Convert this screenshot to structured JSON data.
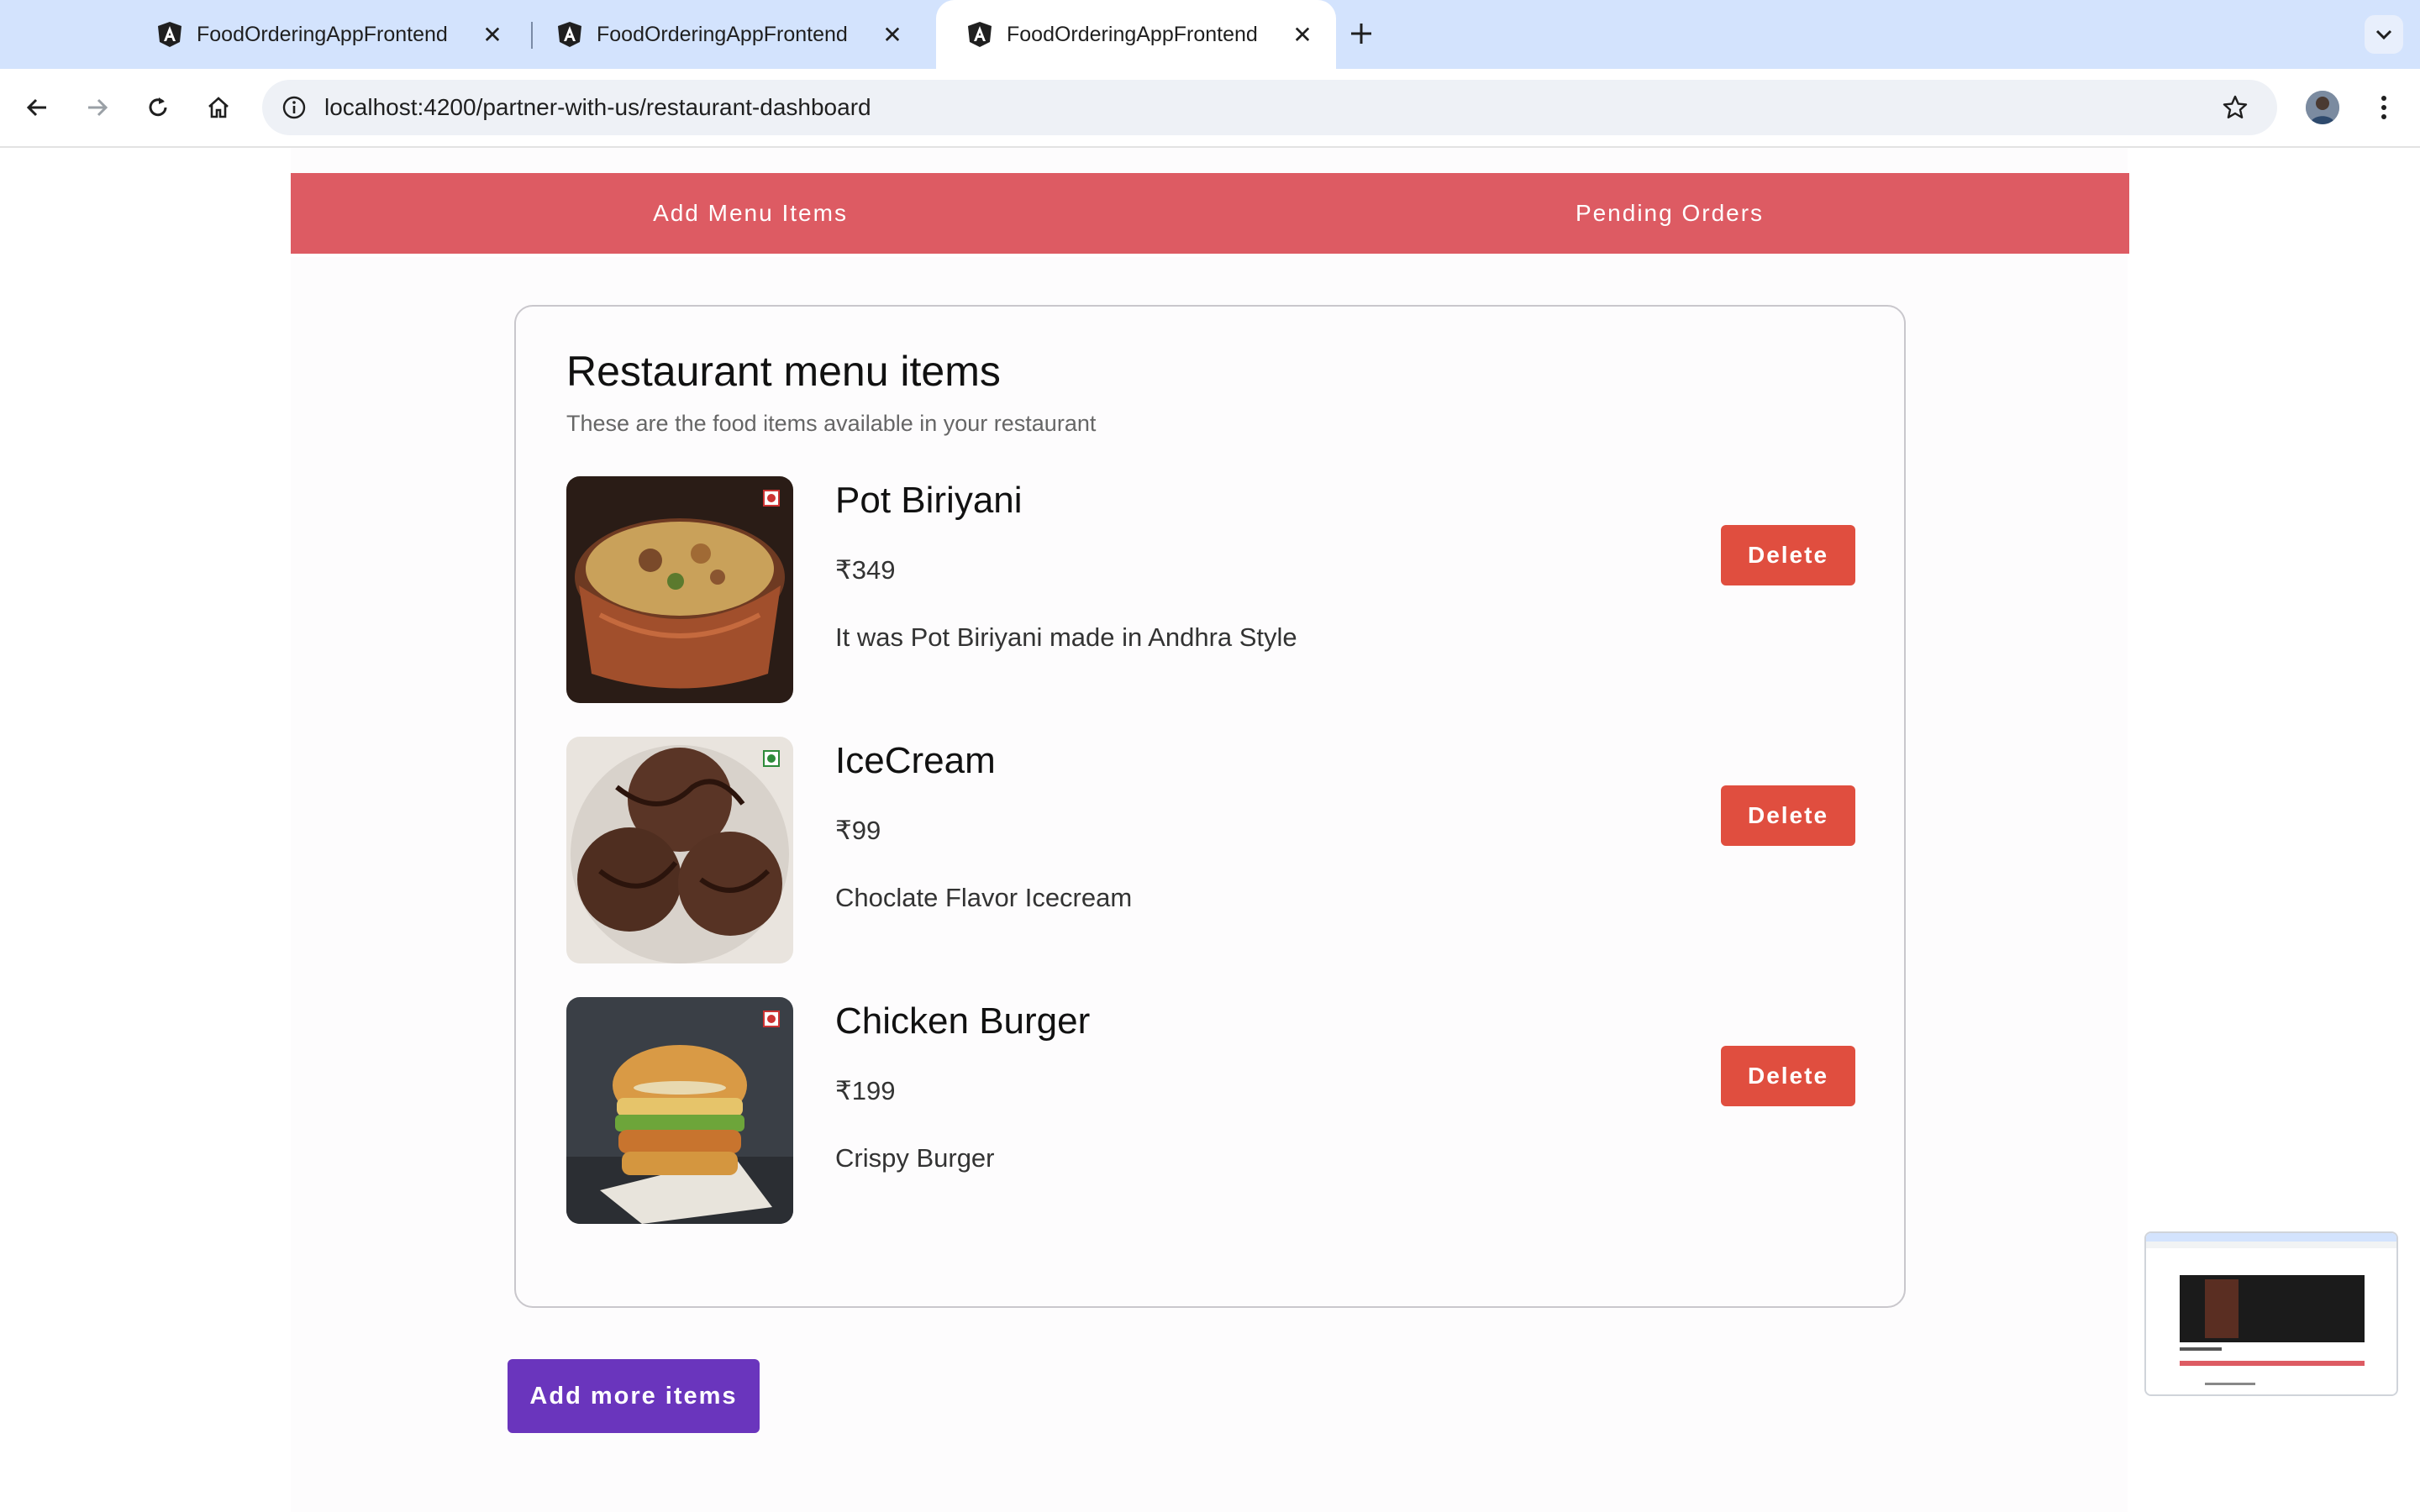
{
  "browser": {
    "tabs": [
      {
        "title": "FoodOrderingAppFrontend",
        "active": false
      },
      {
        "title": "FoodOrderingAppFrontend",
        "active": false
      },
      {
        "title": "FoodOrderingAppFrontend",
        "active": true
      }
    ],
    "new_tab_icon": "plus-icon",
    "tab_close_symbol": "✕",
    "address": {
      "url": "localhost:4200/partner-with-us/restaurant-dashboard"
    }
  },
  "dashboard": {
    "tabs": [
      {
        "label": "Add Menu Items",
        "selected": true
      },
      {
        "label": "Pending Orders",
        "selected": false
      }
    ],
    "tab_color": "#dd5b63"
  },
  "menu_card": {
    "title": "Restaurant menu items",
    "subtitle": "These are the food items available in your restaurant",
    "items": [
      {
        "name": "Pot Biriyani",
        "price": "₹349",
        "description": "It was Pot Biriyani made in Andhra Style",
        "diet": "non-veg",
        "delete_label": "Delete"
      },
      {
        "name": "IceCream",
        "price": "₹99",
        "description": "Choclate Flavor Icecream",
        "diet": "veg",
        "delete_label": "Delete"
      },
      {
        "name": "Chicken Burger",
        "price": "₹199",
        "description": "Crispy Burger",
        "diet": "non-veg",
        "delete_label": "Delete"
      }
    ],
    "delete_color": "#e04e3f"
  },
  "actions": {
    "add_more_label": "Add more items",
    "add_more_color": "#6a35bd"
  }
}
